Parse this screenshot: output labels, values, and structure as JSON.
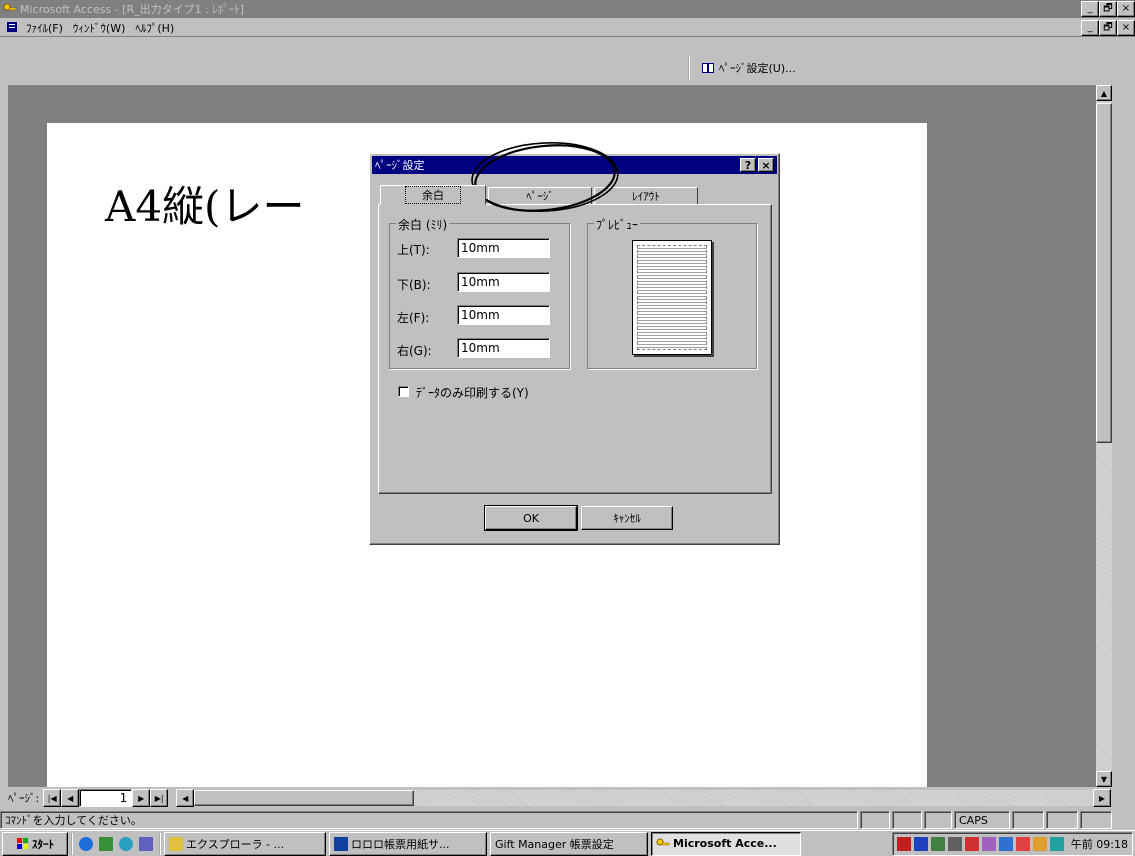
{
  "window": {
    "title": "Microsoft Access - [R_出力タイプ1 : ﾚﾎﾟｰﾄ]",
    "controls": [
      "_",
      "🗗",
      "×"
    ]
  },
  "menu": {
    "items": [
      "ﾌｧｲﾙ(F)",
      "ｳｨﾝﾄﾞｳ(W)",
      "ﾍﾙﾌﾟ(H)"
    ]
  },
  "toolbar": {
    "page_setup_label": "ﾍﾟｰｼﾞ設定(U)..."
  },
  "report": {
    "heading": "A4縦(レー"
  },
  "dialog": {
    "title": "ﾍﾟｰｼﾞ設定",
    "help_label": "?",
    "close_label": "×",
    "tabs": [
      "余白",
      "ﾍﾟｰｼﾞ",
      "ﾚｲｱｳﾄ"
    ],
    "margins_group": "余白 (ﾐﾘ)",
    "preview_group": "ﾌﾟﾚﾋﾞｭｰ",
    "fields": [
      {
        "label": "上(T):",
        "value": "10mm"
      },
      {
        "label": "下(B):",
        "value": "10mm"
      },
      {
        "label": "左(F):",
        "value": "10mm"
      },
      {
        "label": "右(G):",
        "value": "10mm"
      }
    ],
    "data_only_label": "ﾃﾞｰﾀのみ印刷する(Y)",
    "data_only_checked": false,
    "ok_label": "OK",
    "cancel_label": "ｷｬﾝｾﾙ"
  },
  "nav": {
    "page_label": "ﾍﾟｰｼﾞ:",
    "page_number": "1"
  },
  "status": {
    "text": "ｺﾏﾝﾄﾞを入力してください。",
    "caps": "CAPS"
  },
  "taskbar": {
    "start_label": "ｽﾀｰﾄ",
    "tasks": [
      "エクスプローラ - ...",
      "ロロロ帳票用紙サ...",
      "Gift Manager 帳票設定",
      "Microsoft Acce..."
    ],
    "clock": "午前 09:18"
  },
  "colors": {
    "titlebar_inactive": "#808080",
    "dialog_titlebar": "#000080",
    "annotation": "#000000"
  }
}
